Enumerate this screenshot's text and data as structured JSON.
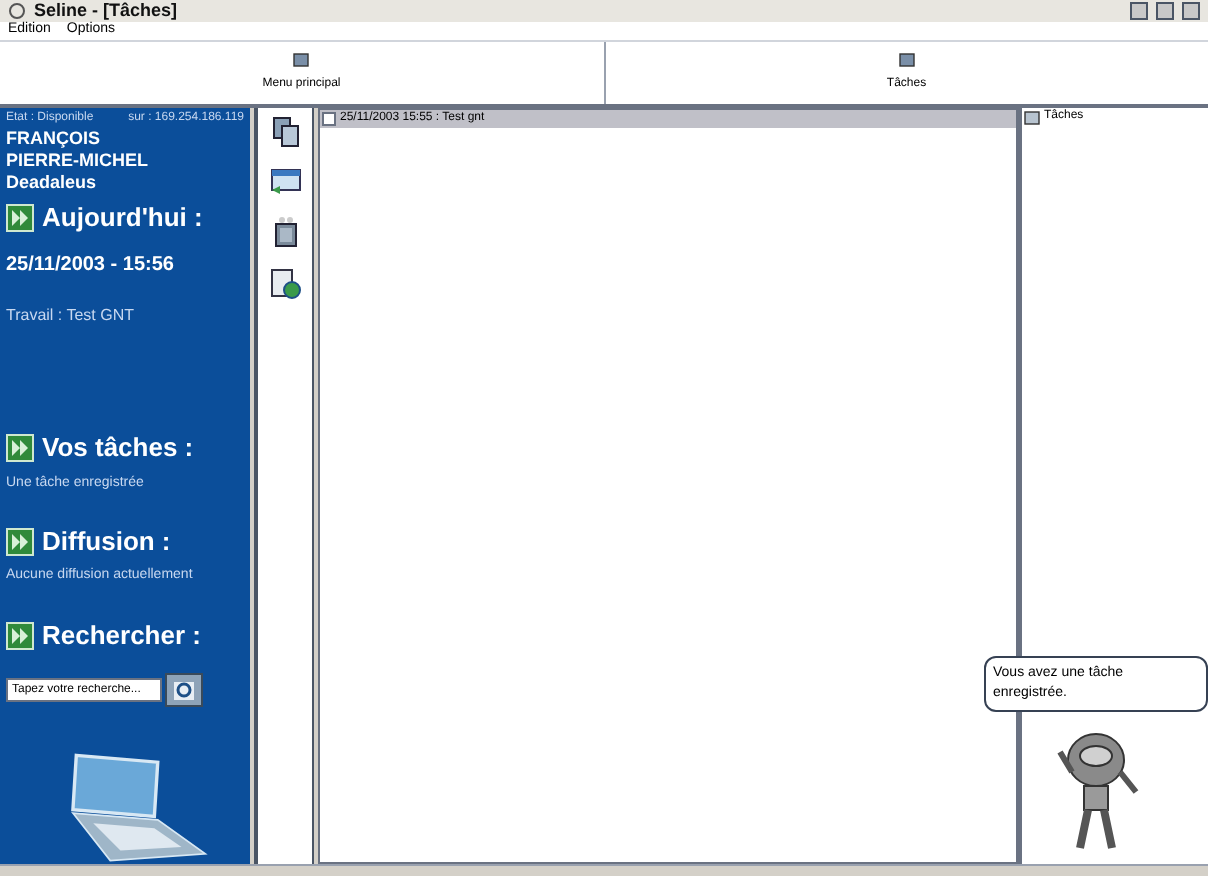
{
  "window": {
    "title": "Seline - [Tâches]"
  },
  "menu": [
    "Edition",
    "Options"
  ],
  "toolbar": [
    "Menu principal",
    "Tâches"
  ],
  "sidebar": {
    "status": "Etat : Disponible",
    "address": "sur : 169.254.186.119",
    "user": [
      "FRANÇOIS",
      "PIERRE-MICHEL",
      "Deadaleus"
    ],
    "sections": [
      {
        "kind": "today",
        "title": "Aujourd'hui :",
        "date": "25/11/2003 - 15:56",
        "detail": "Travail : Test GNT"
      },
      {
        "kind": "info",
        "title": "Vos tâches :",
        "detail": "Une tâche enregistrée"
      },
      {
        "kind": "info",
        "title": "Diffusion :",
        "detail": "Aucune diffusion actuellement"
      },
      {
        "kind": "search",
        "title": "Rechercher :",
        "placeholder": "Tapez votre recherche..."
      }
    ]
  },
  "tasks": [
    {
      "text": "25/11/2003 15:55 : Test gnt",
      "checked": false,
      "selected": true
    }
  ],
  "tree": [
    {
      "label": "Tâches"
    }
  ],
  "assistant": {
    "message": "Vous avez une tâche enregistrée."
  }
}
